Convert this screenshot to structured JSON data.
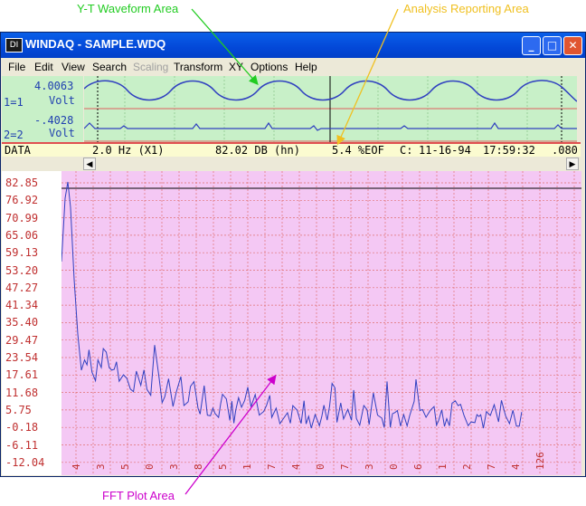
{
  "callouts": {
    "yt": "Y-T Waveform Area",
    "analysis": "Analysis Reporting Area",
    "fft": "FFT Plot Area"
  },
  "window": {
    "icon_text": "DI",
    "title": "WINDAQ - SAMPLE.WDQ",
    "minimize": "_",
    "maximize": "□",
    "close": "✕"
  },
  "menu": [
    "File",
    "Edit",
    "View",
    "Search",
    "Scaling",
    "Transform",
    "XY",
    "Options",
    "Help"
  ],
  "channels": [
    {
      "value": "4.0063",
      "label": "1=1",
      "unit": "Volt"
    },
    {
      "value": "-.4028",
      "label": "2=2",
      "unit": "Volt"
    }
  ],
  "status": {
    "mode": "DATA",
    "freq": "2.0 Hz (X1)",
    "db": "82.02 DB (hn)",
    "eof": "5.4 %EOF",
    "c": "C:",
    "date": "11-16-94",
    "time": "17:59:32",
    "interval": ".080"
  },
  "fft_y_labels": [
    "82.85",
    "76.92",
    "70.99",
    "65.06",
    "59.13",
    "53.20",
    "47.27",
    "41.34",
    "35.40",
    "29.47",
    "23.54",
    "17.61",
    "11.68",
    "5.75",
    "-0.18",
    "-6.11",
    "-12.04"
  ],
  "fft_x_labels": [
    "4",
    "3",
    "5",
    "0",
    "3",
    "8",
    "5",
    "1",
    "7",
    "4",
    "0",
    "7",
    "3",
    "0",
    "6",
    "1",
    "2",
    "7",
    "4",
    "126"
  ],
  "colors": {
    "green_bg": "#c8f0c8",
    "pink_bg": "#f4c8f4",
    "trace": "#3040c0",
    "grid": "#e07070",
    "yt_callout": "#22cc22",
    "analysis_callout": "#f0c020",
    "fft_callout": "#cc00cc"
  }
}
